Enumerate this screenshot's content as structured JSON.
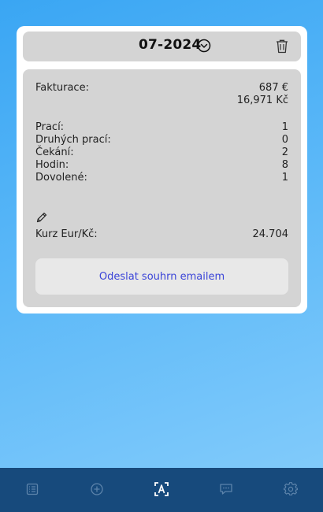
{
  "header": {
    "month": "07-2024",
    "month_picker_icon": "chevron-circle-down-icon",
    "delete_icon": "trash-icon"
  },
  "summary": {
    "invoice_label": "Fakturace:",
    "invoice_eur": "687 €",
    "invoice_czk": "16,971 Kč",
    "stats": [
      {
        "label": "Prací:",
        "value": "1"
      },
      {
        "label": "Druhých prací:",
        "value": "0"
      },
      {
        "label": "Čekání:",
        "value": "2"
      },
      {
        "label": "Hodin:",
        "value": "8"
      },
      {
        "label": "Dovolené:",
        "value": "1"
      }
    ],
    "edit_icon": "pencil-icon",
    "rate_label": "Kurz Eur/Kč:",
    "rate_value": "24.704",
    "send_button": "Odeslat souhrn emailem"
  },
  "navbar": {
    "items": [
      {
        "icon": "list-icon",
        "active": false
      },
      {
        "icon": "add-circle-icon",
        "active": false
      },
      {
        "icon": "text-scan-icon",
        "active": true
      },
      {
        "icon": "chat-icon",
        "active": false
      },
      {
        "icon": "settings-gear-icon",
        "active": false
      }
    ],
    "active_color": "#ffffff",
    "inactive_color": "#5d84ab",
    "background": "#174a7c"
  }
}
